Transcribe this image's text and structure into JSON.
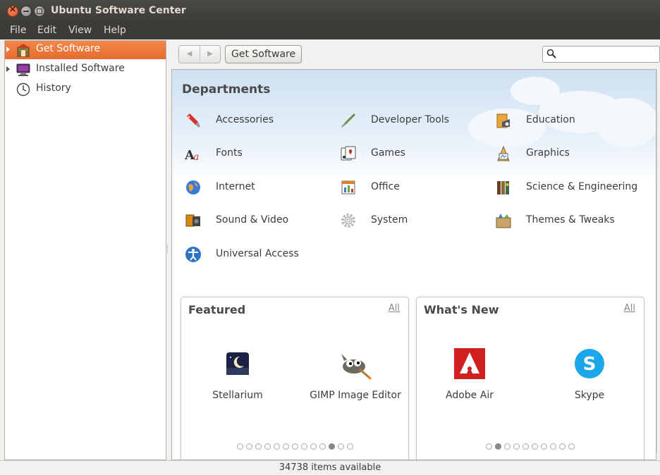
{
  "window": {
    "title": "Ubuntu Software Center"
  },
  "menubar": {
    "file": "File",
    "edit": "Edit",
    "view": "View",
    "help": "Help"
  },
  "sidebar": {
    "items": [
      {
        "label": "Get Software",
        "icon": "store-icon",
        "selected": true
      },
      {
        "label": "Installed Software",
        "icon": "computer-icon",
        "selected": false
      },
      {
        "label": "History",
        "icon": "clock-icon",
        "selected": false
      }
    ]
  },
  "toolbar": {
    "back_icon": "back-arrow-icon",
    "forward_icon": "forward-arrow-icon",
    "breadcrumb": "Get Software",
    "search_value": "",
    "search_icon": "magnifier-icon"
  },
  "departments": {
    "heading": "Departments",
    "items": [
      {
        "label": "Accessories",
        "icon": "accessories-icon"
      },
      {
        "label": "Developer Tools",
        "icon": "developer-tools-icon"
      },
      {
        "label": "Education",
        "icon": "education-icon"
      },
      {
        "label": "Fonts",
        "icon": "fonts-icon"
      },
      {
        "label": "Games",
        "icon": "games-icon"
      },
      {
        "label": "Graphics",
        "icon": "graphics-icon"
      },
      {
        "label": "Internet",
        "icon": "internet-icon"
      },
      {
        "label": "Office",
        "icon": "office-icon"
      },
      {
        "label": "Science & Engineering",
        "icon": "science-icon"
      },
      {
        "label": "Sound & Video",
        "icon": "sound-video-icon"
      },
      {
        "label": "System",
        "icon": "system-icon"
      },
      {
        "label": "Themes & Tweaks",
        "icon": "themes-icon"
      },
      {
        "label": "Universal Access",
        "icon": "universal-access-icon"
      }
    ]
  },
  "featured": {
    "title": "Featured",
    "all_link": "All",
    "apps": [
      {
        "name": "Stellarium",
        "icon": "stellarium-icon"
      },
      {
        "name": "GIMP Image Editor",
        "icon": "gimp-icon"
      }
    ],
    "page_count": 13,
    "current_page": 11
  },
  "whats_new": {
    "title": "What's New",
    "all_link": "All",
    "apps": [
      {
        "name": "Adobe Air",
        "icon": "adobe-air-icon"
      },
      {
        "name": "Skype",
        "icon": "skype-icon"
      }
    ],
    "page_count": 10,
    "current_page": 2
  },
  "status": {
    "text": "34738 items available"
  },
  "colors": {
    "selection": "#e66b2e",
    "titlebar": "#3c3b37"
  }
}
